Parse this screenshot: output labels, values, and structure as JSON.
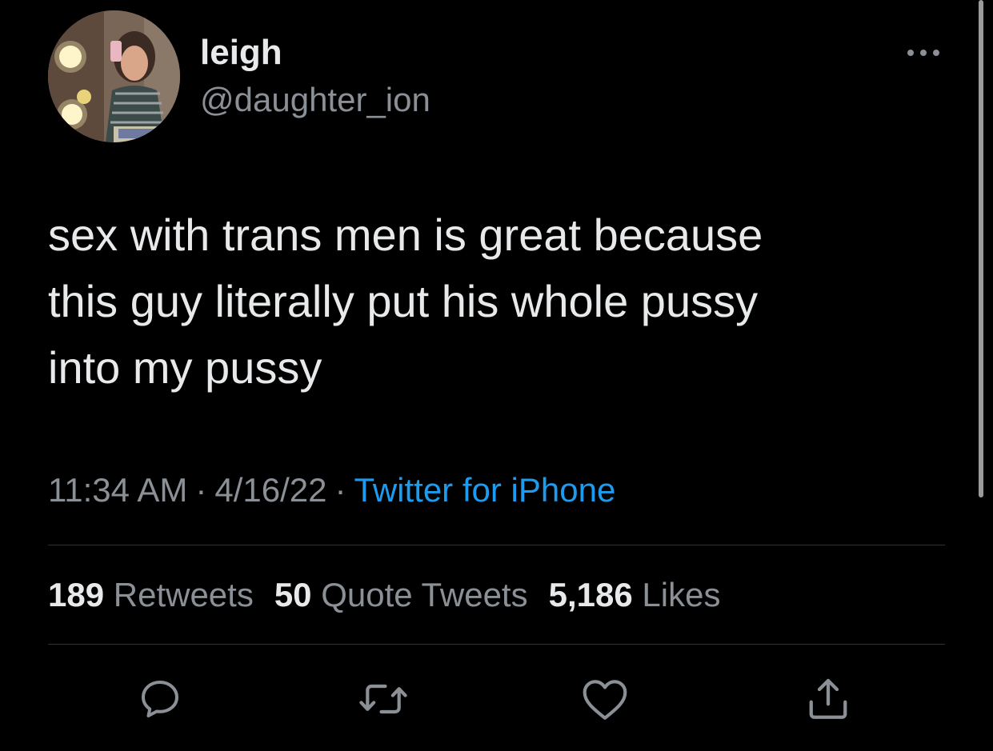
{
  "author": {
    "display_name": "leigh",
    "handle": "@daughter_ion",
    "avatar_icon": "profile-photo"
  },
  "more_icon": "ellipsis-icon",
  "tweet": {
    "text": "sex with trans men is great because\nthis guy literally put his whole pussy\ninto my pussy",
    "time": "11:34 AM",
    "separator": "·",
    "date": "4/16/22",
    "source": "Twitter for iPhone"
  },
  "stats": {
    "retweets_count": "189",
    "retweets_label": "Retweets",
    "quotes_count": "50",
    "quotes_label": "Quote Tweets",
    "likes_count": "5,186",
    "likes_label": "Likes"
  },
  "actions": {
    "reply_icon": "reply-icon",
    "retweet_icon": "retweet-icon",
    "like_icon": "heart-icon",
    "share_icon": "share-icon"
  },
  "colors": {
    "background": "#000000",
    "primary_text": "#e7e9ea",
    "secondary_text": "#8b9096",
    "link": "#1d9bf0",
    "divider": "#2f3336"
  }
}
